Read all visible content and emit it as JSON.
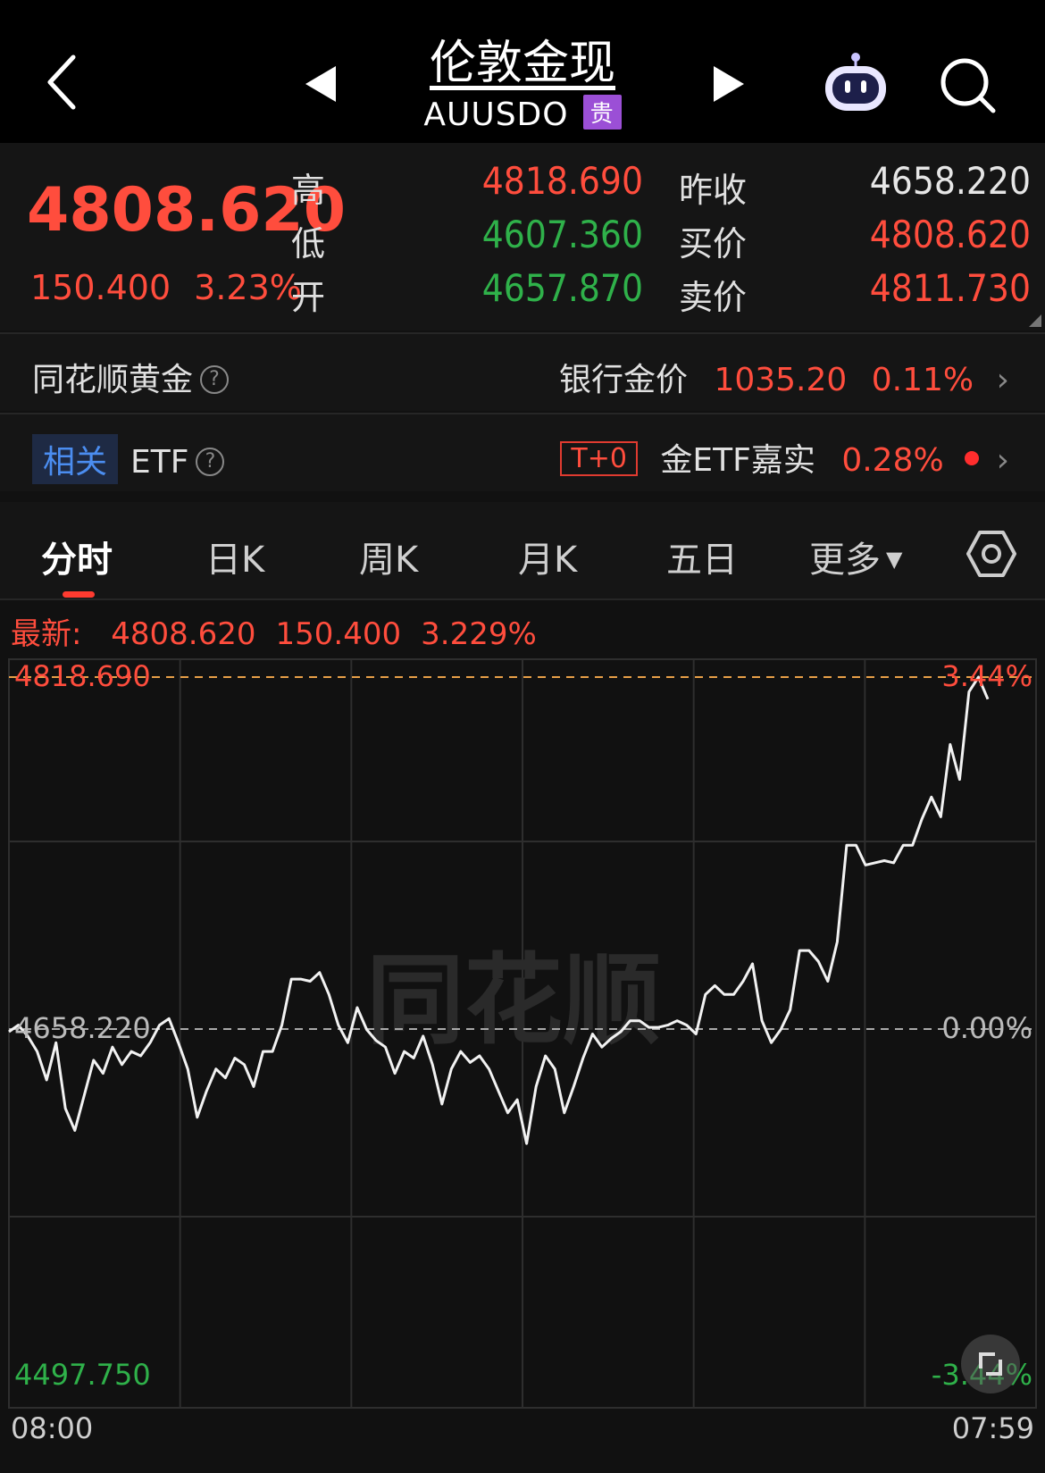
{
  "header": {
    "title": "伦敦金现",
    "symbol": "AUUSDO",
    "badge": "贵"
  },
  "quote": {
    "price": "4808.620",
    "change": "150.400",
    "change_pct": "3.23%",
    "high_label": "高",
    "high": "4818.690",
    "low_label": "低",
    "low": "4607.360",
    "open_label": "开",
    "open": "4657.870",
    "prev_close_label": "昨收",
    "prev_close": "4658.220",
    "bid_label": "买价",
    "bid": "4808.620",
    "ask_label": "卖价",
    "ask": "4811.730"
  },
  "gold_row": {
    "label": "同花顺黄金",
    "help": "?",
    "bank_label": "银行金价",
    "bank_price": "1035.20",
    "bank_pct": "0.11%"
  },
  "etf_row": {
    "tag": "相关",
    "label": "ETF",
    "help": "?",
    "t0": "T+0",
    "etf_name": "金ETF嘉实",
    "etf_pct": "0.28%"
  },
  "tabs": [
    "分时",
    "日K",
    "周K",
    "月K",
    "五日",
    "更多"
  ],
  "latest": {
    "label": "最新:",
    "price": "4808.620",
    "change": "150.400",
    "pct": "3.229%"
  },
  "colors": {
    "up": "#ff4d3d",
    "down": "#2fb14a",
    "line": "#ffffff",
    "bg": "#111111"
  },
  "chart_data": {
    "type": "line",
    "y_labels": {
      "top": "4818.690",
      "mid": "4658.220",
      "bottom": "4497.750"
    },
    "pct_labels": {
      "top": "3.44%",
      "mid": "0.00%",
      "bottom": "-3.44%"
    },
    "x_labels": [
      "08:00",
      "07:59"
    ],
    "ylim": [
      4497.75,
      4818.69
    ],
    "reference_line": 4658.22,
    "series": [
      {
        "values": [
          4657,
          4660,
          4655,
          4648,
          4635,
          4652,
          4622,
          4612,
          4628,
          4644,
          4638,
          4650,
          4642,
          4648,
          4646,
          4652,
          4660,
          4663,
          4652,
          4640,
          4618,
          4630,
          4640,
          4636,
          4645,
          4642,
          4632,
          4648,
          4648,
          4660,
          4681,
          4681,
          4680,
          4684,
          4674,
          4660,
          4652,
          4668,
          4658,
          4653,
          4650,
          4638,
          4648,
          4645,
          4655,
          4642,
          4624,
          4640,
          4648,
          4643,
          4646,
          4640,
          4630,
          4620,
          4626,
          4606,
          4632,
          4646,
          4640,
          4620,
          4632,
          4645,
          4656,
          4650,
          4654,
          4657,
          4662,
          4662,
          4659,
          4659,
          4660,
          4662,
          4660,
          4656,
          4674,
          4678,
          4674,
          4674,
          4680,
          4688,
          4662,
          4652,
          4658,
          4667,
          4694,
          4694,
          4689,
          4680,
          4698,
          4742,
          4742,
          4733,
          4734,
          4735,
          4734,
          4742,
          4742,
          4754,
          4764,
          4755,
          4788,
          4772,
          4812,
          4818.69,
          4808.62
        ]
      }
    ]
  }
}
